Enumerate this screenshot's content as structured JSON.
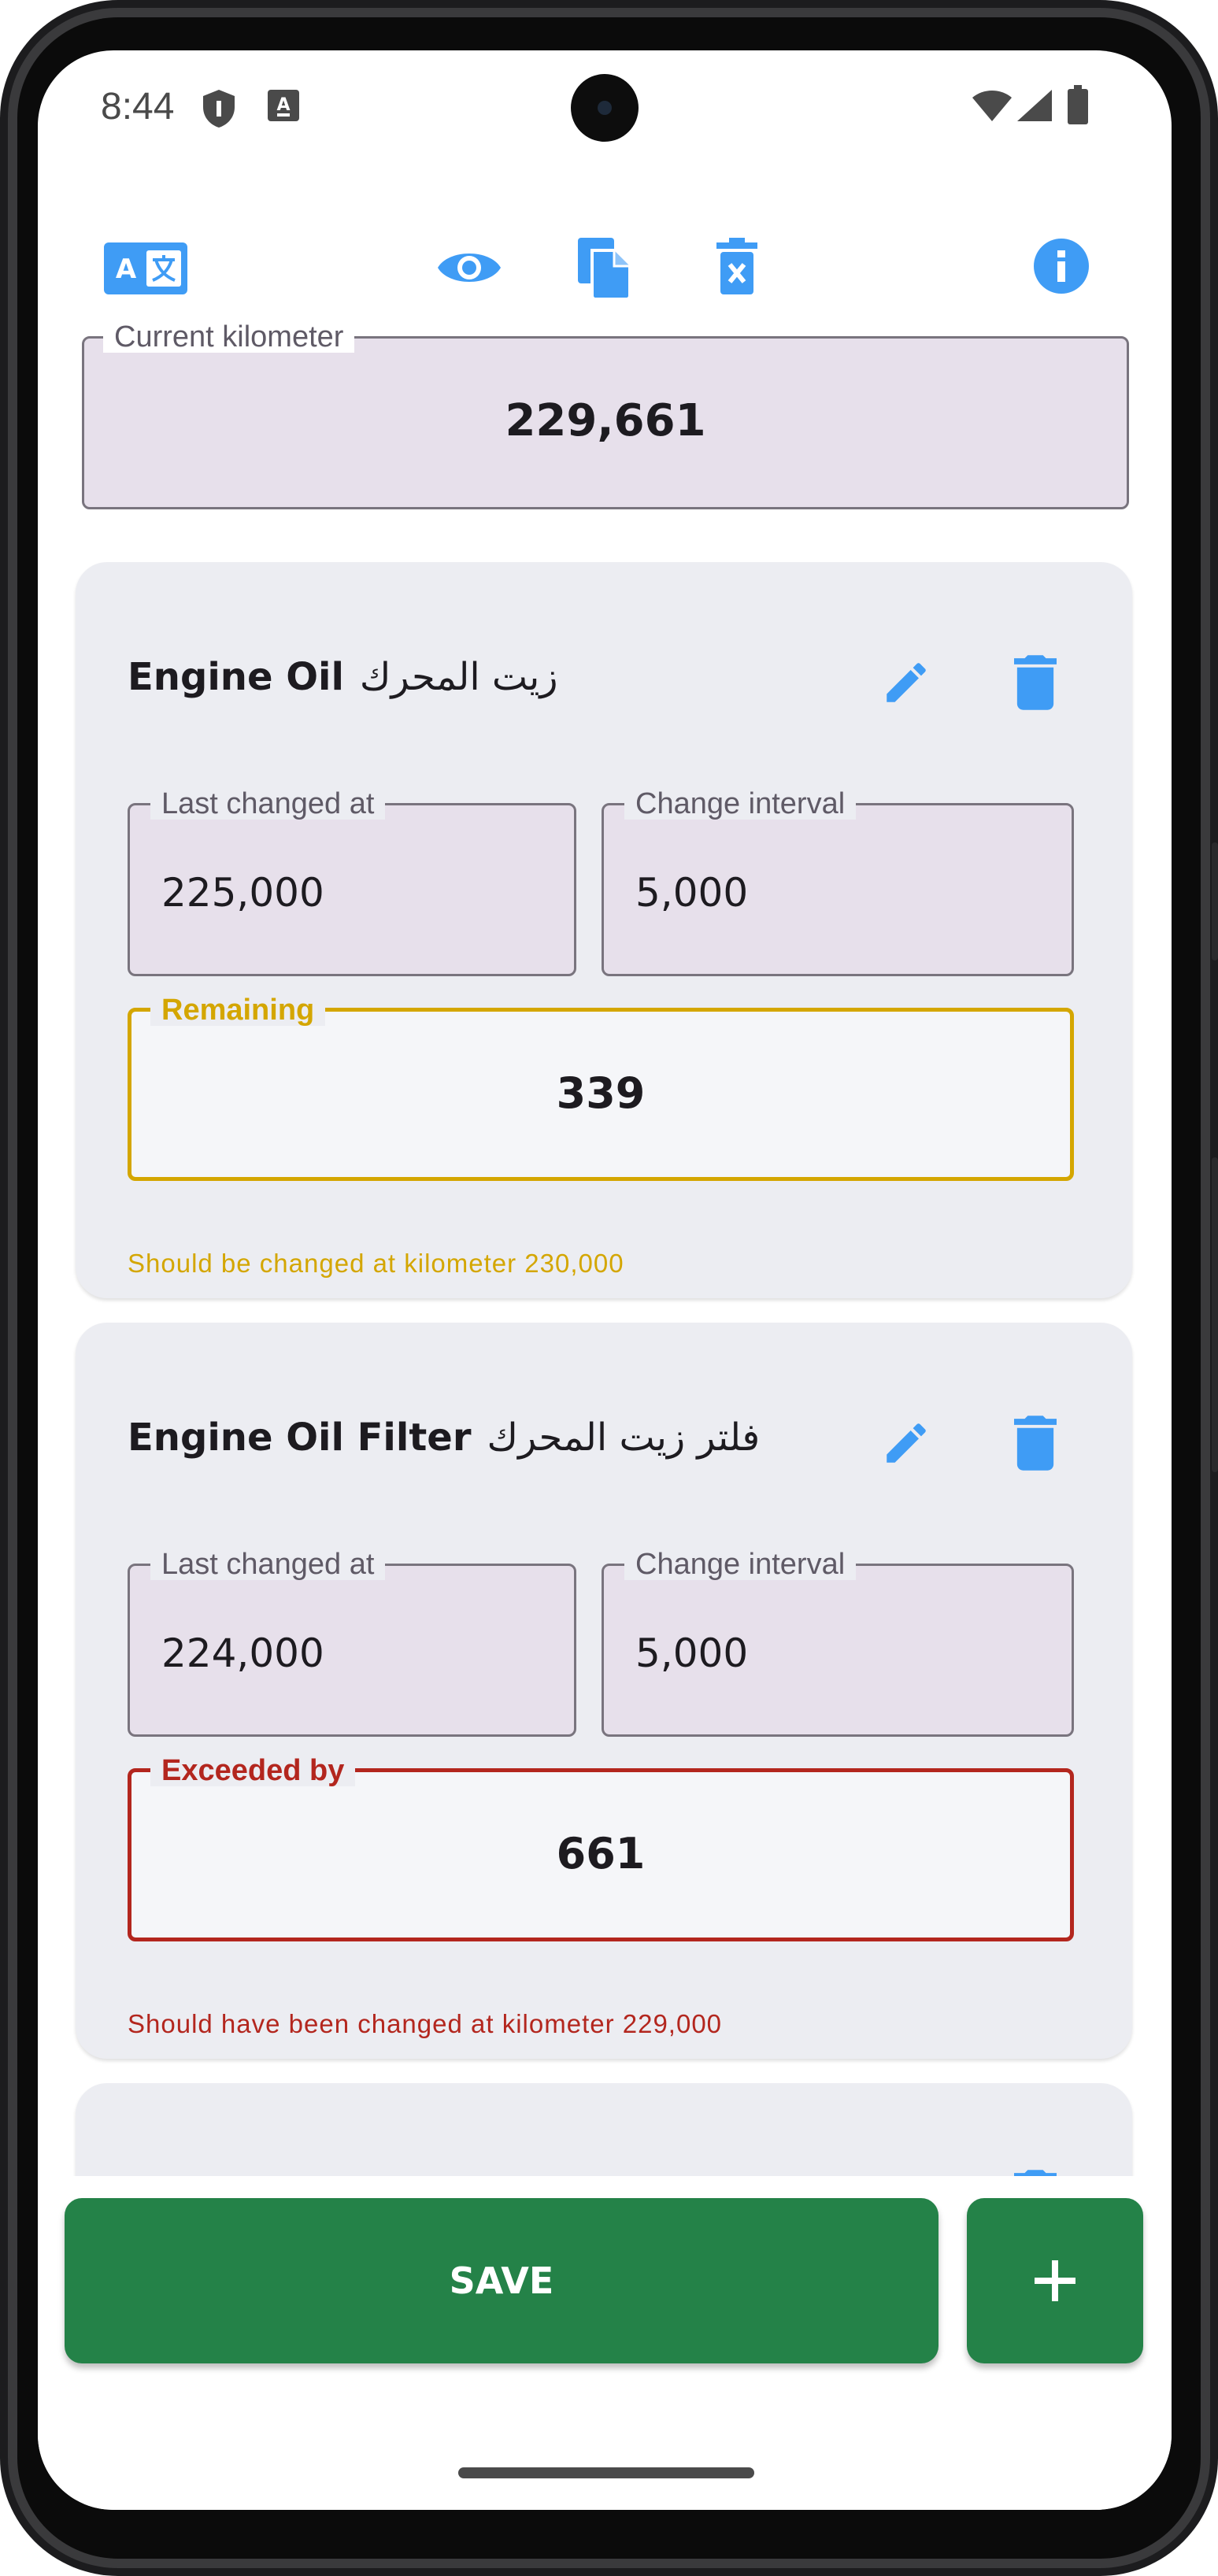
{
  "status_bar": {
    "time": "8:44"
  },
  "toolbar": {
    "icons": [
      "translate-icon",
      "eye-icon",
      "copy-icon",
      "clear-delete-icon",
      "info-icon"
    ],
    "accent_color": "#3f9cf5"
  },
  "current_km": {
    "label": "Current kilometer",
    "value": "229,661"
  },
  "items": [
    {
      "name_en": "Engine Oil",
      "name_ar": "زيت المحرك",
      "last_changed_label": "Last changed at",
      "last_changed_value": "225,000",
      "interval_label": "Change interval",
      "interval_value": "5,000",
      "status_label": "Remaining",
      "status_value": "339",
      "status_color": "#d4a600",
      "helper": "Should be changed at kilometer 230,000"
    },
    {
      "name_en": "Engine Oil Filter",
      "name_ar": "فلتر زيت المحرك",
      "last_changed_label": "Last changed at",
      "last_changed_value": "224,000",
      "interval_label": "Change interval",
      "interval_value": "5,000",
      "status_label": "Exceeded by",
      "status_value": "661",
      "status_color": "#b3261e",
      "helper": "Should have been changed at kilometer 229,000"
    }
  ],
  "actions": {
    "save_label": "SAVE",
    "button_color": "#248248"
  }
}
